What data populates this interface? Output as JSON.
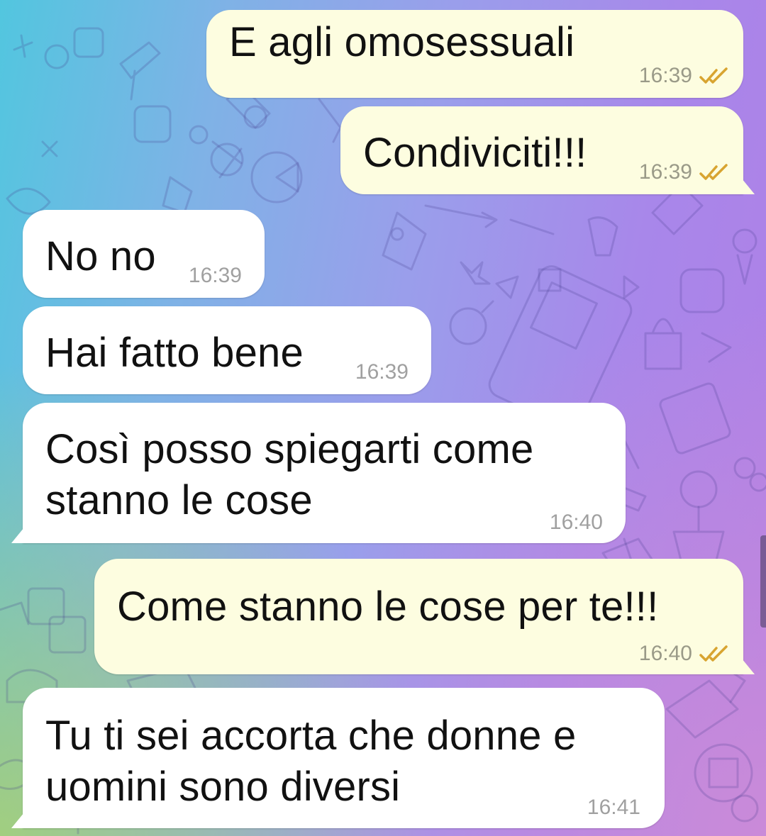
{
  "messages": [
    {
      "id": "m1",
      "direction": "outgoing",
      "text": "E agli omosessuali",
      "time": "16:39",
      "status_icon": "double-check-icon"
    },
    {
      "id": "m2",
      "direction": "outgoing",
      "text": "Condiviciti!!!",
      "time": "16:39",
      "status_icon": "double-check-icon"
    },
    {
      "id": "m3",
      "direction": "incoming",
      "text": "No no",
      "time": "16:39"
    },
    {
      "id": "m4",
      "direction": "incoming",
      "text": "Hai fatto bene",
      "time": "16:39"
    },
    {
      "id": "m5",
      "direction": "incoming",
      "text": "Così posso spiegarti come\nstanno le cose",
      "time": "16:40"
    },
    {
      "id": "m6",
      "direction": "outgoing",
      "text": "Come stanno le  cose per te!!!",
      "time": "16:40",
      "status_icon": "double-check-icon"
    },
    {
      "id": "m7",
      "direction": "incoming",
      "text": "Tu ti sei accorta che donne e\nuomini sono diversi",
      "time": "16:41"
    }
  ],
  "colors": {
    "outgoing_bubble": "#fdfde0",
    "incoming_bubble": "#ffffff",
    "read_checks": "#d8a430",
    "gradient": [
      "#52c6df",
      "#9a9eeb",
      "#b07fe6"
    ]
  }
}
